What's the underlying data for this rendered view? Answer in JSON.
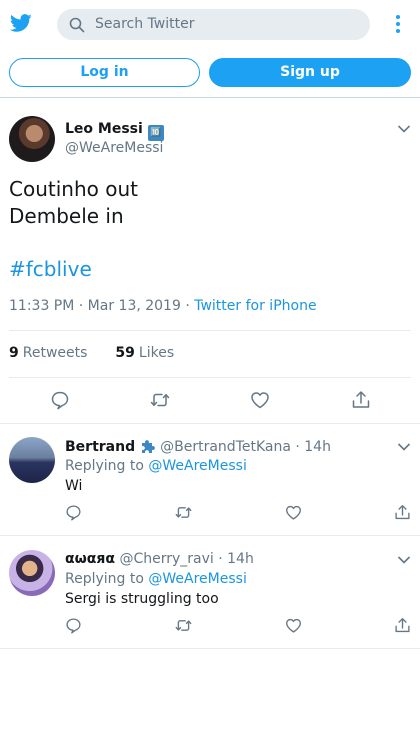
{
  "colors": {
    "brand": "#1da1f2",
    "link": "#1b95e0",
    "muted": "#657786",
    "text": "#14171a",
    "search_bg": "#e6ecf0"
  },
  "header": {
    "logo_icon": "twitter-bird-icon",
    "search_placeholder": "Search Twitter",
    "more_icon": "vertical-dots-icon",
    "login_label": "Log in",
    "signup_label": "Sign up"
  },
  "tweet": {
    "author_name": "Leo Messi",
    "author_badge": "🔟",
    "author_handle": "@WeAreMessi",
    "text_line1": "Coutinho out",
    "text_line2": "Dembele in",
    "hashtag": "#fcblive",
    "time": "11:33 PM · Mar 13, 2019 · ",
    "source": "Twitter for iPhone",
    "retweets_count": "9",
    "retweets_label": "Retweets",
    "likes_count": "59",
    "likes_label": "Likes"
  },
  "replies": [
    {
      "name": "Bertrand",
      "name_icon": "puzzle-piece-icon",
      "handle": "@BertrandTetKana",
      "time": " · 14h",
      "replying_prefix": "Replying to ",
      "replying_to": "@WeAreMessi",
      "text": "Wi"
    },
    {
      "name": "αωαяα",
      "handle": " @Cherry_ravi",
      "time": " · 14h",
      "replying_prefix": "Replying to ",
      "replying_to": "@WeAreMessi",
      "text": "Sergi is struggling too"
    }
  ]
}
